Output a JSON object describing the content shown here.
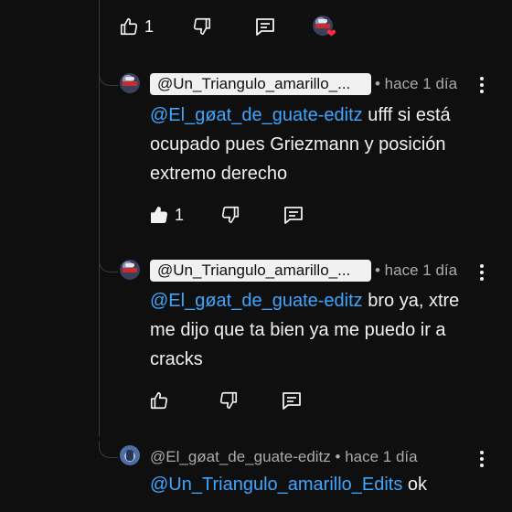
{
  "top_actions": {
    "like_count": "1"
  },
  "replies": [
    {
      "author": "@Un_Triangulo_amarillo_...",
      "time": "• hace 1 día",
      "mention": "@El_gøat_de_guate-editz",
      "text": " ufff si está ocupado pues Griezmann y posición extremo derecho",
      "likes": "1",
      "like_filled": true
    },
    {
      "author": "@Un_Triangulo_amarillo_...",
      "time": "• hace 1 día",
      "mention": "@El_gøat_de_guate-editz",
      "text": " bro ya, xtre me dijo que ta bien ya me puedo ir a cracks",
      "likes": "",
      "like_filled": false
    },
    {
      "author": "@El_gøat_de_guate-editz",
      "time": "• hace 1 día",
      "mention": "@Un_Triangulo_amarillo_Edits",
      "text": " ok",
      "likes": "",
      "like_filled": false
    }
  ],
  "icons": {
    "like": "thumb-up-icon",
    "dislike": "thumb-down-icon",
    "reply": "comment-icon",
    "creator_heart": "heart-icon",
    "menu": "kebab-menu-icon"
  },
  "colors": {
    "background": "#0f0f0f",
    "mention": "#3ea6ff",
    "heart": "#ff2a3c"
  }
}
